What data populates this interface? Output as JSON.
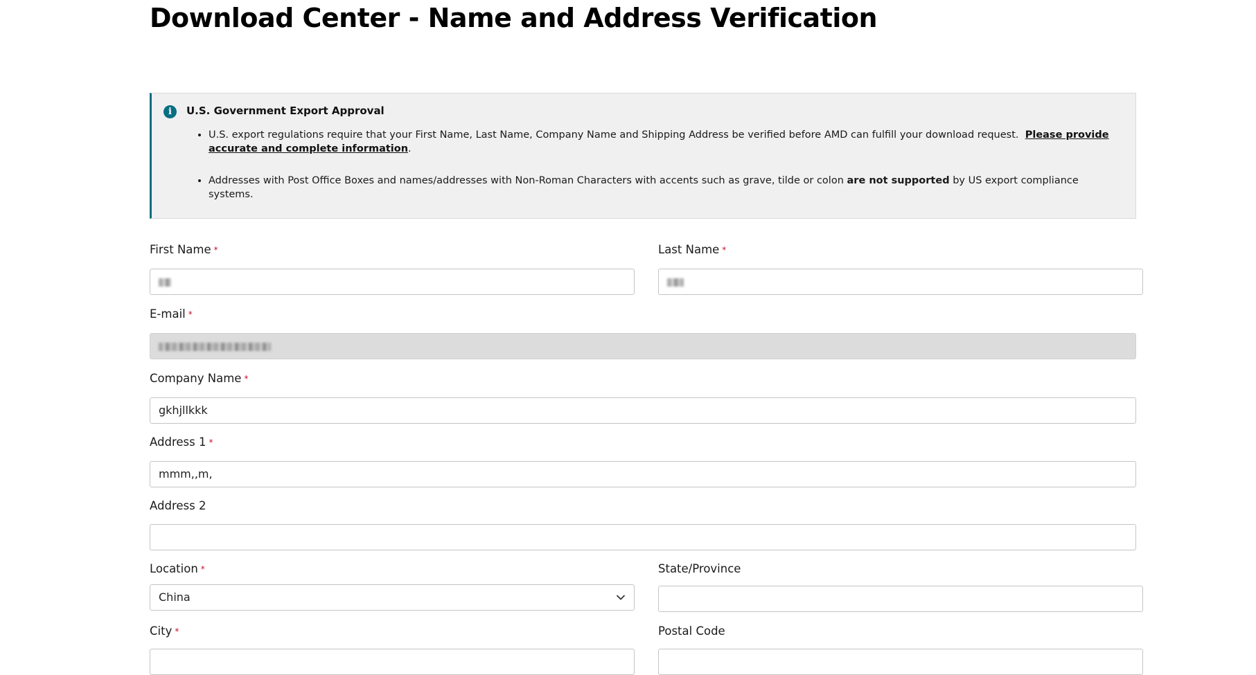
{
  "page": {
    "title": "Download Center - Name and Address Verification"
  },
  "notice": {
    "icon": "info-icon",
    "accent_color": "#0a6e82",
    "title": "U.S. Government Export Approval",
    "bullet1_text": "U.S. export regulations require that your First Name, Last Name, Company Name and Shipping Address be verified before AMD can fulfill your download request.",
    "bullet1_link": "Please provide accurate and complete information",
    "bullet1_end": ".",
    "bullet2_pre": "Addresses with Post Office Boxes and names/addresses with Non-Roman Characters with accents such as grave, tilde or colon",
    "bullet2_bold": "are not supported",
    "bullet2_post": "by US export compliance systems."
  },
  "form": {
    "required_marker": "*",
    "first_name": {
      "label": "First Name",
      "value": ""
    },
    "last_name": {
      "label": "Last Name",
      "value": ""
    },
    "email": {
      "label": "E-mail",
      "value": ""
    },
    "company": {
      "label": "Company Name",
      "value": "gkhjllkkk"
    },
    "address1": {
      "label": "Address 1",
      "value": "mmm,,m,"
    },
    "address2": {
      "label": "Address 2",
      "value": ""
    },
    "location": {
      "label": "Location",
      "value": "China"
    },
    "state": {
      "label": "State/Province",
      "value": ""
    },
    "city": {
      "label": "City",
      "value": ""
    },
    "postal": {
      "label": "Postal Code",
      "value": ""
    }
  }
}
